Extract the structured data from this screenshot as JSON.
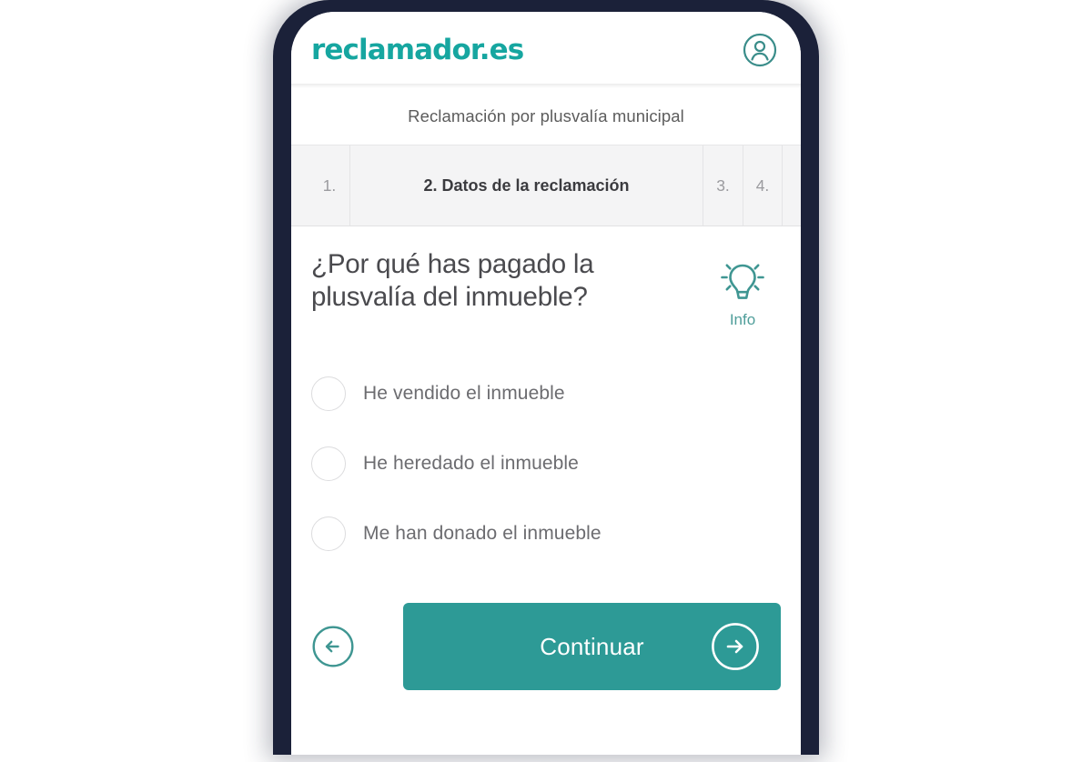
{
  "brand": {
    "logo_text": "reclamador.es",
    "logo_color": "#16a6a0",
    "account_icon": "account-circle-icon"
  },
  "header": {
    "page_title": "Reclamación por plusvalía municipal"
  },
  "steps": [
    {
      "label": "1.",
      "active": false
    },
    {
      "label": "2. Datos de la reclamación",
      "active": true
    },
    {
      "label": "3.",
      "active": false
    },
    {
      "label": "4.",
      "active": false
    }
  ],
  "question": {
    "title": "¿Por qué has pagado la plusvalía del inmueble?",
    "info": {
      "icon": "lightbulb-icon",
      "label": "Info",
      "color": "#4f9e9a"
    }
  },
  "options": [
    {
      "label": "He vendido el inmueble",
      "selected": false
    },
    {
      "label": "He heredado el inmueble",
      "selected": false
    },
    {
      "label": "Me han donado el inmueble",
      "selected": false
    }
  ],
  "actions": {
    "back": {
      "icon": "arrow-left-circle-icon",
      "label": ""
    },
    "continue": {
      "label": "Continuar",
      "icon": "arrow-right-circle-icon",
      "color": "#2d9a96"
    }
  },
  "theme": {
    "teal": "#2d9a96",
    "brand_teal": "#16a6a0",
    "bezel": "#1b2139",
    "tabbar_bg": "#f4f4f5",
    "text_dark": "#4a4a4e",
    "text_muted": "#9b9b9f"
  }
}
